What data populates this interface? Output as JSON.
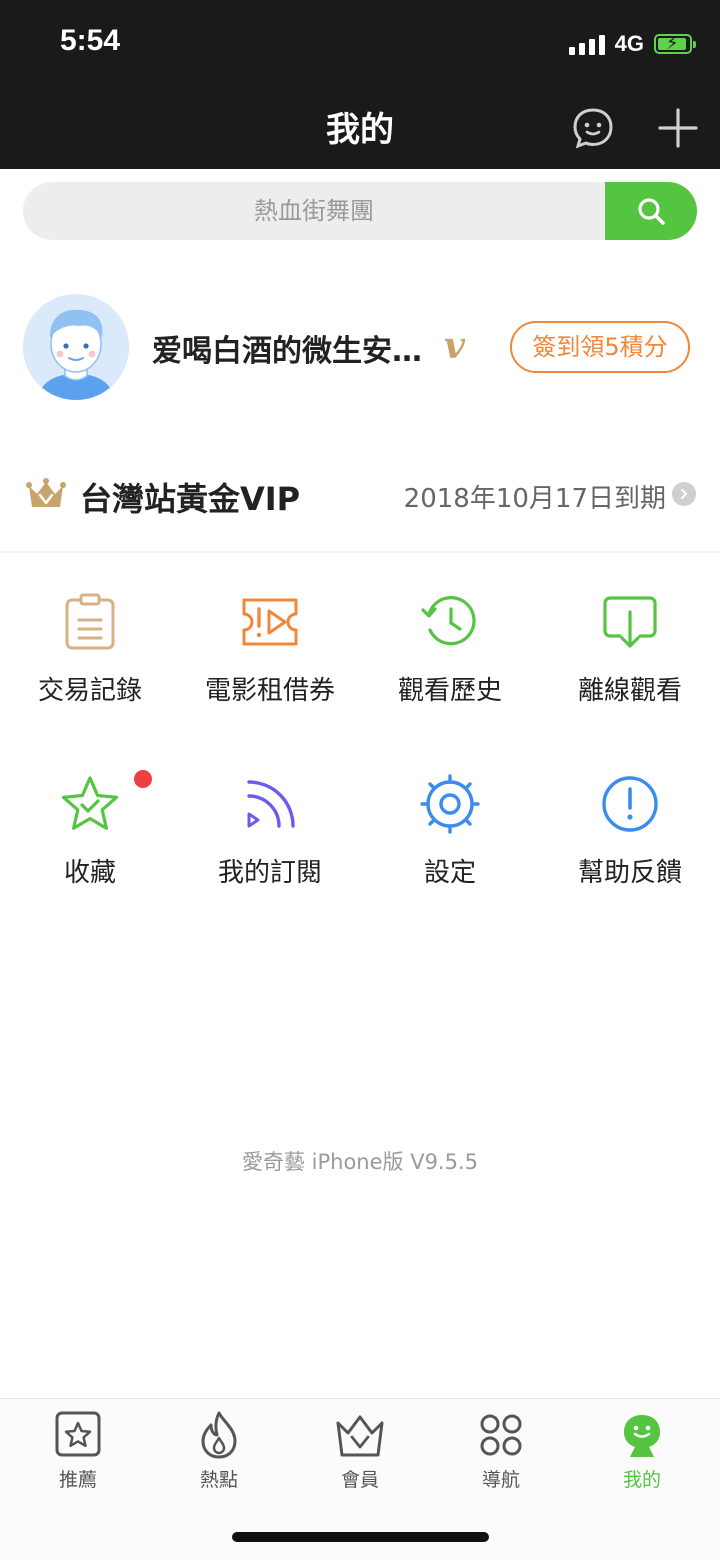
{
  "status_bar": {
    "time": "5:54",
    "network": "4G"
  },
  "header": {
    "title": "我的"
  },
  "search": {
    "placeholder": "熱血街舞團"
  },
  "profile": {
    "username": "爱喝白酒的微生安…",
    "vip_mark": "v",
    "checkin_label": "簽到領5積分"
  },
  "vip": {
    "title": "台灣站黃金VIP",
    "expire": "2018年10月17日到期"
  },
  "grid": [
    {
      "label": "交易記錄"
    },
    {
      "label": "電影租借券"
    },
    {
      "label": "觀看歷史"
    },
    {
      "label": "離線觀看"
    },
    {
      "label": "收藏"
    },
    {
      "label": "我的訂閱"
    },
    {
      "label": "設定"
    },
    {
      "label": "幫助反饋"
    }
  ],
  "version": "愛奇藝 iPhone版 V9.5.5",
  "tabs": [
    {
      "label": "推薦"
    },
    {
      "label": "熱點"
    },
    {
      "label": "會員"
    },
    {
      "label": "導航"
    },
    {
      "label": "我的"
    }
  ],
  "colors": {
    "accent": "#55c440",
    "checkin": "#f0873a",
    "gold": "#c9a36a",
    "header_bg": "#1a1a1a"
  }
}
